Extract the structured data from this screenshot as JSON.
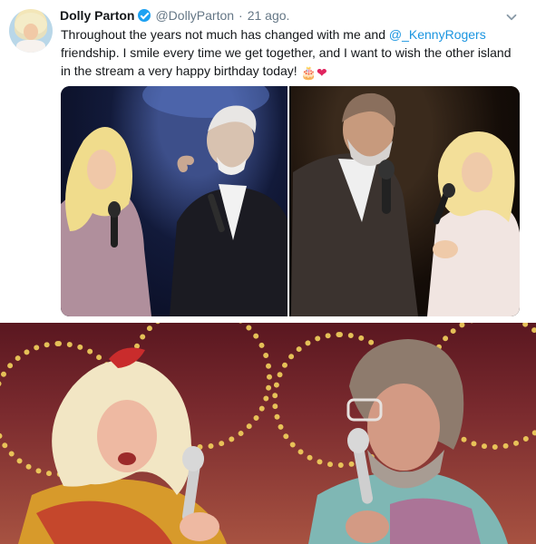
{
  "tweet": {
    "author": {
      "display_name": "Dolly Parton",
      "handle": "@DollyParton",
      "verified": true,
      "avatar_icon": "profile-photo"
    },
    "separator": "·",
    "timestamp": "21 ago.",
    "text": {
      "part1": "Throughout the years not much has changed with me and ",
      "mention": "@_KennyRogers",
      "part2": " friendship. I smile every time we get together, and I want to wish the other island in the stream a very happy birthday today! ",
      "emojis": [
        "🎂",
        "❤"
      ]
    },
    "colors": {
      "link": "#1b95e0",
      "secondary_text": "#657786",
      "verified_badge": "#1da1f2"
    },
    "media": {
      "photo_count": 2
    },
    "menu_icon": "chevron-down-icon"
  },
  "still_image": {
    "icon": "concert-still-photo"
  }
}
